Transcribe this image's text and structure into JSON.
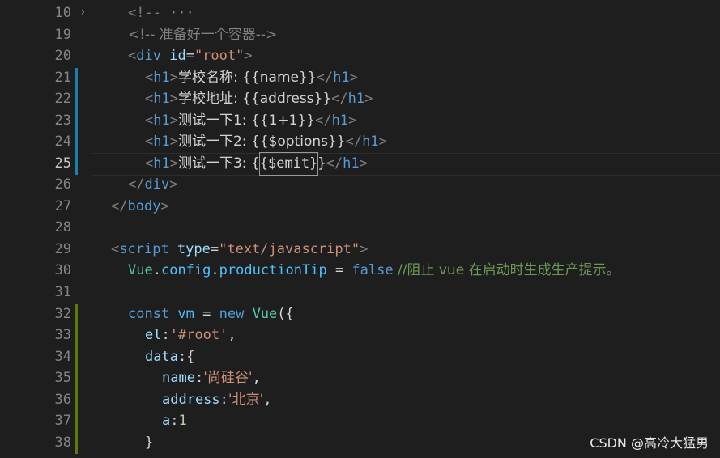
{
  "editor": {
    "line_numbers": [
      "10",
      "19",
      "20",
      "21",
      "22",
      "23",
      "24",
      "25",
      "26",
      "27",
      "28",
      "29",
      "30",
      "31",
      "32",
      "33",
      "34",
      "35",
      "36",
      "37",
      "38"
    ],
    "active_line": "25",
    "fold_chevron": "›",
    "colors": {
      "background": "#1e1e1e",
      "scm_modified": "#1b81a8",
      "scm_added": "#587c0c"
    }
  },
  "code": {
    "l10": {
      "open": "<!--",
      "fold": " ···"
    },
    "l19": {
      "text": "<!-- 准备好一个容器-->"
    },
    "l20": {
      "lt": "<",
      "tag": "div",
      "attr": " id",
      "eq": "=",
      "val": "\"root\"",
      "gt": ">"
    },
    "l21": {
      "open_tag": "h1",
      "content": "学校名称: {{name}}",
      "close_tag": "h1"
    },
    "l22": {
      "open_tag": "h1",
      "content": "学校地址: {{address}}",
      "close_tag": "h1"
    },
    "l23": {
      "open_tag": "h1",
      "content": "测试一下1: {{1+1}}",
      "close_tag": "h1"
    },
    "l24": {
      "open_tag": "h1",
      "content": "测试一下2: {{$options}}",
      "close_tag": "h1"
    },
    "l25": {
      "open_tag": "h1",
      "content_pre": "测试一下3: {",
      "boxed": "{$emit}",
      "content_post": "}",
      "close_tag": "h1"
    },
    "l26": {
      "tag": "div"
    },
    "l27": {
      "tag": "body"
    },
    "l29": {
      "tag": "script",
      "attr": " type",
      "val": "\"text/javascript\""
    },
    "l30": {
      "obj": "Vue",
      "prop1": "config",
      "prop2": "productionTip",
      "op": " = ",
      "kw": "false",
      "comment": " //阻止 vue 在启动时生成生产提示。"
    },
    "l32": {
      "kw1": "const",
      "var": " vm",
      "op": " = ",
      "kw2": "new",
      "cls": " Vue",
      "punc": "({"
    },
    "l33": {
      "key": "el",
      "colon": ":",
      "val": "'#root'",
      "comma": ","
    },
    "l34": {
      "key": "data",
      "rest": ":{"
    },
    "l35": {
      "key": "name",
      "colon": ":",
      "val": "'尚硅谷'",
      "comma": ","
    },
    "l36": {
      "key": "address",
      "colon": ":",
      "val": "'北京'",
      "comma": ","
    },
    "l37": {
      "key": "a",
      "colon": ":",
      "num": "1"
    },
    "l38": {
      "text": "}"
    }
  },
  "watermark": "CSDN @高冷大猛男"
}
